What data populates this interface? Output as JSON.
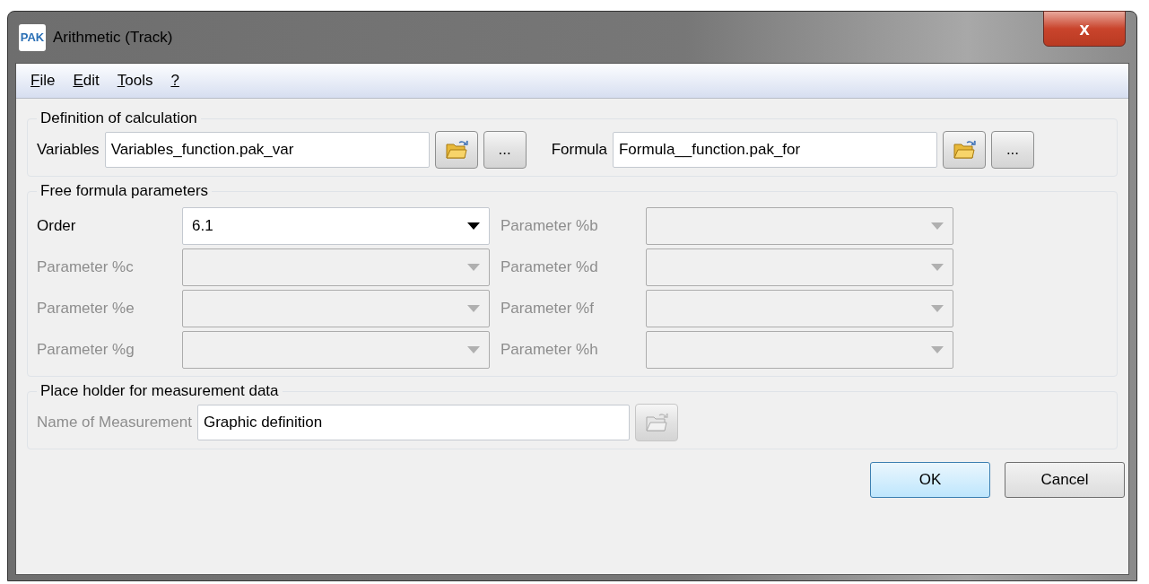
{
  "window": {
    "title": "Arithmetic (Track)",
    "logo": "PAK",
    "close": "x"
  },
  "menu": [
    {
      "label": "File",
      "mnemonic_underlined": true
    },
    {
      "label": "Edit",
      "mnemonic_underlined": true
    },
    {
      "label": "Tools",
      "mnemonic_underlined": true
    },
    {
      "label": "?",
      "mnemonic_underlined": true
    }
  ],
  "definition": {
    "title": "Definition of calculation",
    "fields": [
      {
        "label": "Variables",
        "value": "Variables_function.pak_var",
        "browse_disabled": false,
        "more": "..."
      },
      {
        "label": "Formula",
        "value": "Formula__function.pak_for",
        "browse_disabled": false,
        "more": "..."
      }
    ]
  },
  "parameters": {
    "title": "Free formula parameters",
    "items": [
      {
        "label": "Order",
        "value": "6.1",
        "disabled": false
      },
      {
        "label": "Parameter %b",
        "disabled": true
      },
      {
        "label": "Parameter %c",
        "disabled": true
      },
      {
        "label": "Parameter %d",
        "disabled": true
      },
      {
        "label": "Parameter %e",
        "disabled": true
      },
      {
        "label": "Parameter %f",
        "disabled": true
      },
      {
        "label": "Parameter %g",
        "disabled": true
      },
      {
        "label": "Parameter %h",
        "disabled": true
      }
    ]
  },
  "placeholder_group": {
    "title": "Place holder for measurement data",
    "label": "Name of Measurement",
    "label_disabled": true,
    "value": "Graphic definition",
    "browse_disabled": true
  },
  "buttons": [
    {
      "label": "OK",
      "default": true
    },
    {
      "label": "Cancel",
      "default": false
    }
  ]
}
